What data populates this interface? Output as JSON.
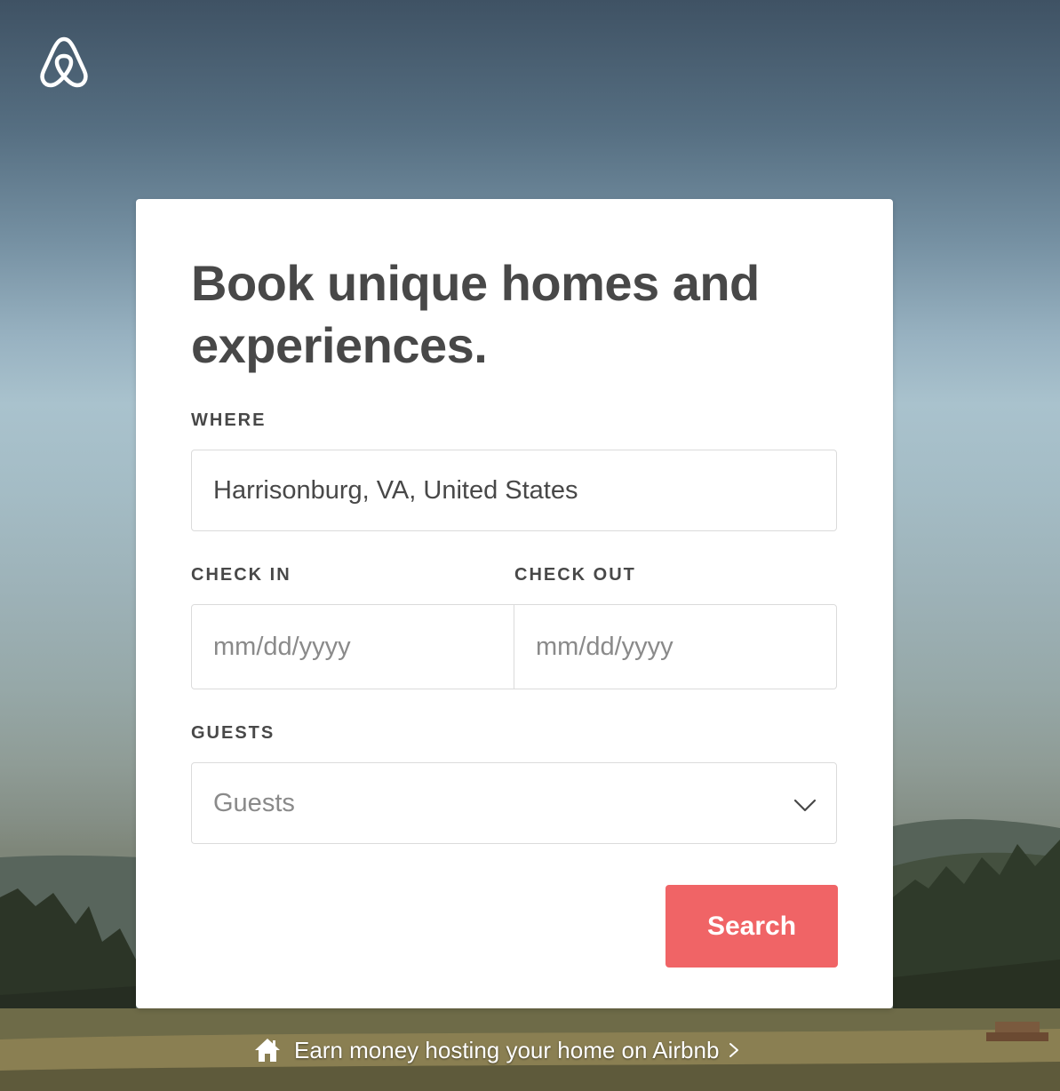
{
  "brand": {
    "logo_icon": "airbnb-belo-logo-icon",
    "accent_color": "#f06466"
  },
  "card": {
    "headline": "Book unique homes and experiences.",
    "where": {
      "label": "WHERE",
      "value": "Harrisonburg, VA, United States"
    },
    "check_in": {
      "label": "CHECK IN",
      "placeholder": "mm/dd/yyyy"
    },
    "check_out": {
      "label": "CHECK OUT",
      "placeholder": "mm/dd/yyyy"
    },
    "guests": {
      "label": "GUESTS",
      "placeholder": "Guests",
      "icon": "chevron-down-icon"
    },
    "search_label": "Search"
  },
  "footer": {
    "host_link": "Earn money hosting your home on Airbnb",
    "host_icon": "home-icon",
    "link_icon": "chevron-right-icon"
  }
}
